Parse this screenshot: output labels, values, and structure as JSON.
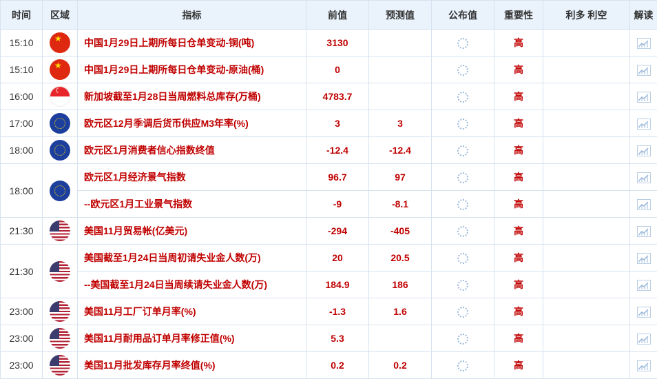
{
  "headers": [
    "时间",
    "区域",
    "指标",
    "前值",
    "预测值",
    "公布值",
    "重要性",
    "利多 利空",
    "解读"
  ],
  "icons": {
    "published": "loading-spinner-icon",
    "interpret": "chart-icon"
  },
  "colors": {
    "text_red": "#c00000",
    "header_bg": "#eaf3fc",
    "border": "#d6e2ef"
  },
  "groups": [
    {
      "time": "15:10",
      "flag": "cn",
      "rows": [
        {
          "indicator": "中国1月29日上期所每日仓单变动-铜(吨)",
          "previous": "3130",
          "forecast": "",
          "importance": "高"
        }
      ]
    },
    {
      "time": "15:10",
      "flag": "cn",
      "rows": [
        {
          "indicator": "中国1月29日上期所每日仓单变动-原油(桶)",
          "previous": "0",
          "forecast": "",
          "importance": "高"
        }
      ]
    },
    {
      "time": "16:00",
      "flag": "sg",
      "rows": [
        {
          "indicator": "新加坡截至1月28日当周燃料总库存(万桶)",
          "previous": "4783.7",
          "forecast": "",
          "importance": "高"
        }
      ]
    },
    {
      "time": "17:00",
      "flag": "eu",
      "rows": [
        {
          "indicator": "欧元区12月季调后货币供应M3年率(%)",
          "previous": "3",
          "forecast": "3",
          "importance": "高"
        }
      ]
    },
    {
      "time": "18:00",
      "flag": "eu",
      "rows": [
        {
          "indicator": "欧元区1月消费者信心指数终值",
          "previous": "-12.4",
          "forecast": "-12.4",
          "importance": "高"
        }
      ]
    },
    {
      "time": "18:00",
      "flag": "eu",
      "rows": [
        {
          "indicator": "欧元区1月经济景气指数",
          "previous": "96.7",
          "forecast": "97",
          "importance": "高"
        },
        {
          "indicator": "--欧元区1月工业景气指数",
          "previous": "-9",
          "forecast": "-8.1",
          "importance": "高"
        }
      ]
    },
    {
      "time": "21:30",
      "flag": "us",
      "rows": [
        {
          "indicator": "美国11月贸易帐(亿美元)",
          "previous": "-294",
          "forecast": "-405",
          "importance": "高"
        }
      ]
    },
    {
      "time": "21:30",
      "flag": "us",
      "rows": [
        {
          "indicator": "美国截至1月24日当周初请失业金人数(万)",
          "previous": "20",
          "forecast": "20.5",
          "importance": "高"
        },
        {
          "indicator": "--美国截至1月24日当周续请失业金人数(万)",
          "previous": "184.9",
          "forecast": "186",
          "importance": "高"
        }
      ]
    },
    {
      "time": "23:00",
      "flag": "us",
      "rows": [
        {
          "indicator": "美国11月工厂订单月率(%)",
          "previous": "-1.3",
          "forecast": "1.6",
          "importance": "高"
        }
      ]
    },
    {
      "time": "23:00",
      "flag": "us",
      "rows": [
        {
          "indicator": "美国11月耐用品订单月率修正值(%)",
          "previous": "5.3",
          "forecast": "",
          "importance": "高"
        }
      ]
    },
    {
      "time": "23:00",
      "flag": "us",
      "rows": [
        {
          "indicator": "美国11月批发库存月率终值(%)",
          "previous": "0.2",
          "forecast": "0.2",
          "importance": "高"
        }
      ]
    }
  ]
}
